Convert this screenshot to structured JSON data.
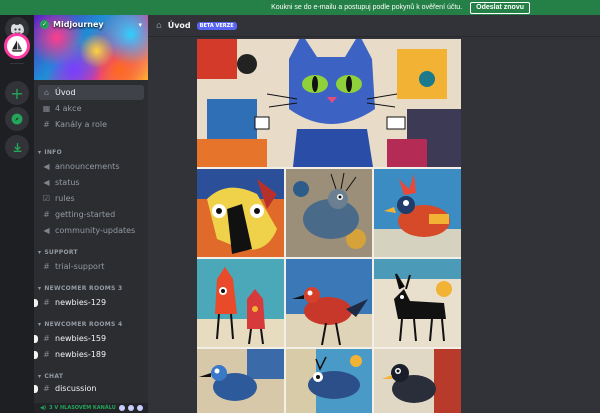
{
  "notice": {
    "text": "Koukni se do e-mailu a postupuj podle pokynů k ověření účtu.",
    "button": "Odeslat znovu"
  },
  "server": {
    "name": "Midjourney"
  },
  "channels": [
    {
      "label": "Úvod",
      "icon": "home-icon",
      "active": true
    },
    {
      "label": "4 akce",
      "icon": "calendar-icon"
    },
    {
      "label": "Kanály a role",
      "icon": "hash-icon"
    }
  ],
  "categories": {
    "info": "INFO",
    "support": "SUPPORT",
    "newcomer3": "NEWCOMER ROOMS 3",
    "newcomer4": "NEWCOMER ROOMS 4",
    "chat": "CHAT"
  },
  "info_channels": [
    "announcements",
    "status",
    "rules",
    "getting-started",
    "community-updates"
  ],
  "support_channels": [
    "trial-support"
  ],
  "newcomer3_channels": [
    "newbies-129"
  ],
  "newcomer4_channels": [
    "newbies-159",
    "newbies-189"
  ],
  "chat_channels": [
    "discussion"
  ],
  "voice": {
    "label": "3 V HLASOVÉM KANÁLU"
  },
  "header": {
    "title": "Úvod",
    "badge": "BETA VERZE"
  },
  "colors": {
    "accent": "#5865f2",
    "notice": "#248046",
    "highlight": "#ff3aa5"
  }
}
